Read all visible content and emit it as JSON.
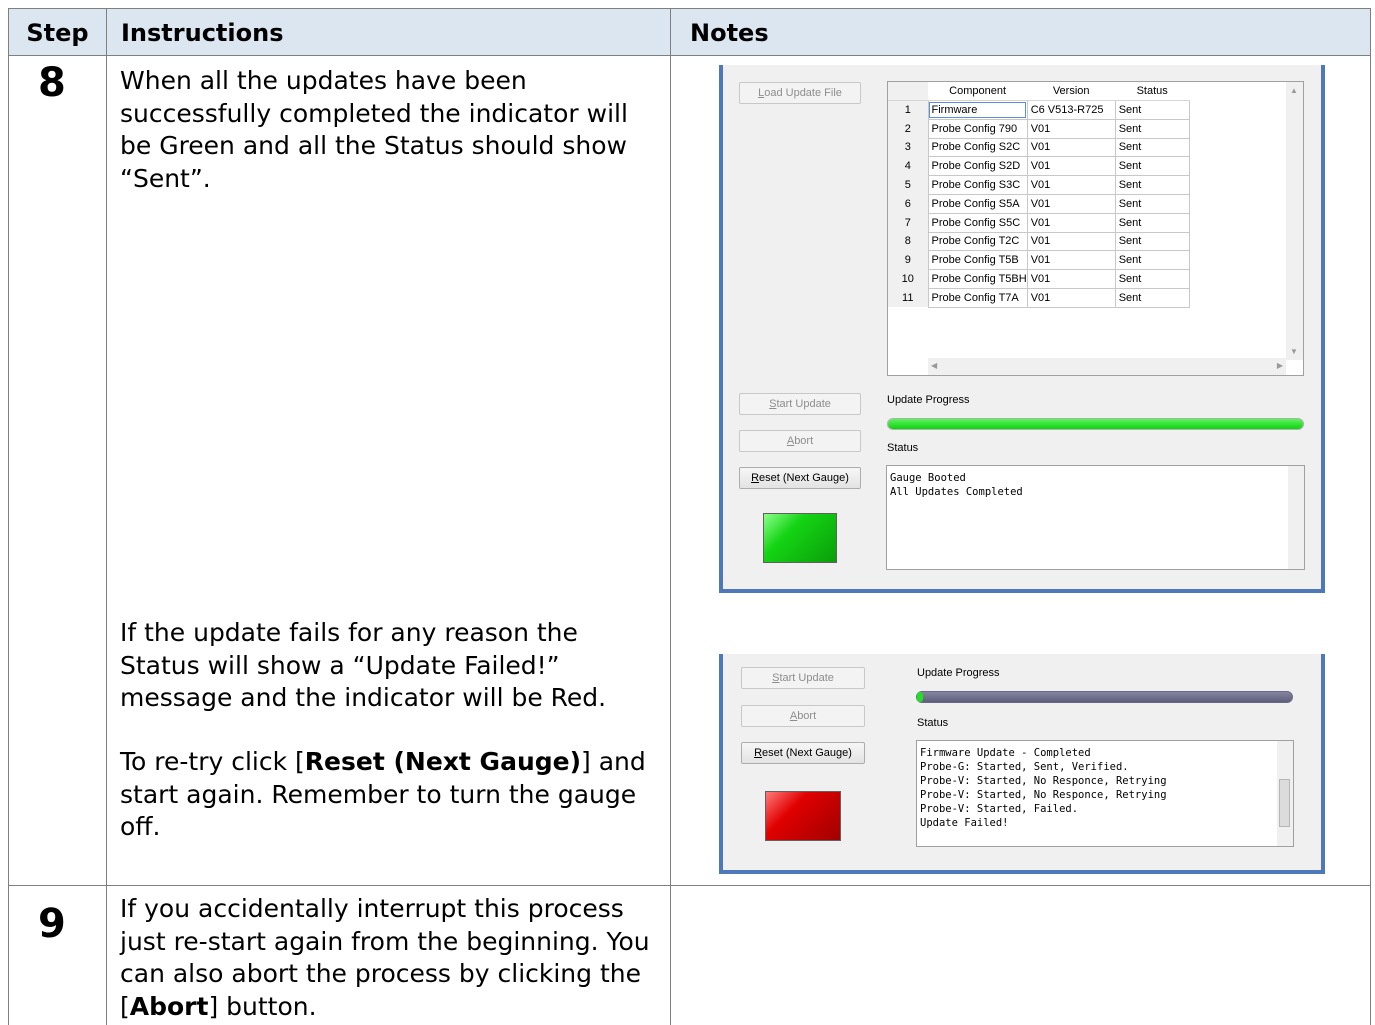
{
  "table": {
    "headers": {
      "step": "Step",
      "instructions": "Instructions",
      "notes": "Notes"
    }
  },
  "step8": {
    "number": "8",
    "para1": "When all the updates have been successfully completed the indicator will be Green and all the Status should show “Sent”.",
    "para2": "If the update fails for any reason the Status will show a “Update Failed!” message and the indicator will be Red.",
    "para3": {
      "pre": "To re-try click [",
      "bold": "Reset (Next Gauge)",
      "post": "] and start again. Remember to turn the gauge off."
    }
  },
  "step9": {
    "number": "9",
    "para": {
      "pre": "If you accidentally interrupt this process just re-start again from the beginning. You can also abort the process by clicking the [",
      "bold": "Abort",
      "post": "] button."
    }
  },
  "shot1": {
    "buttons": {
      "load": "Load Update File",
      "start": "Start Update",
      "abort": "Abort",
      "reset": "Reset (Next Gauge)"
    },
    "grid_headers": [
      "Component",
      "Version",
      "Status"
    ],
    "rows": [
      {
        "n": "1",
        "component": "Firmware",
        "version": "C6 V513-R725",
        "status": "Sent"
      },
      {
        "n": "2",
        "component": "Probe Config 790",
        "version": "V01",
        "status": "Sent"
      },
      {
        "n": "3",
        "component": "Probe Config S2C",
        "version": "V01",
        "status": "Sent"
      },
      {
        "n": "4",
        "component": "Probe Config S2D",
        "version": "V01",
        "status": "Sent"
      },
      {
        "n": "5",
        "component": "Probe Config S3C",
        "version": "V01",
        "status": "Sent"
      },
      {
        "n": "6",
        "component": "Probe Config S5A",
        "version": "V01",
        "status": "Sent"
      },
      {
        "n": "7",
        "component": "Probe Config S5C",
        "version": "V01",
        "status": "Sent"
      },
      {
        "n": "8",
        "component": "Probe Config T2C",
        "version": "V01",
        "status": "Sent"
      },
      {
        "n": "9",
        "component": "Probe Config T5B",
        "version": "V01",
        "status": "Sent"
      },
      {
        "n": "10",
        "component": "Probe Config T5BH",
        "version": "V01",
        "status": "Sent"
      },
      {
        "n": "11",
        "component": "Probe Config T7A",
        "version": "V01",
        "status": "Sent"
      }
    ],
    "progress_label": "Update Progress",
    "progress_fraction": 1.0,
    "status_label": "Status",
    "log": [
      "Gauge Booted",
      "All Updates Completed"
    ],
    "indicator": "green"
  },
  "shot2": {
    "buttons": {
      "start": "Start Update",
      "abort": "Abort",
      "reset": "Reset (Next Gauge)"
    },
    "progress_label": "Update Progress",
    "progress_fraction": 0.01,
    "status_label": "Status",
    "log": [
      "Firmware Update - Completed",
      "Probe-G: Started, Sent, Verified.",
      "Probe-V: Started, No Responce, Retrying",
      "Probe-V: Started, No Responce, Retrying",
      "Probe-V: Started, Failed.",
      "Update Failed!"
    ],
    "indicator": "red"
  },
  "colors": {
    "header_bg": "#dce6f1",
    "progress_green": "#22e022",
    "progress_grey": "#6b6b88",
    "lamp_green": "#14d414",
    "lamp_red": "#d40000",
    "window_frame": "#4f78b9"
  }
}
